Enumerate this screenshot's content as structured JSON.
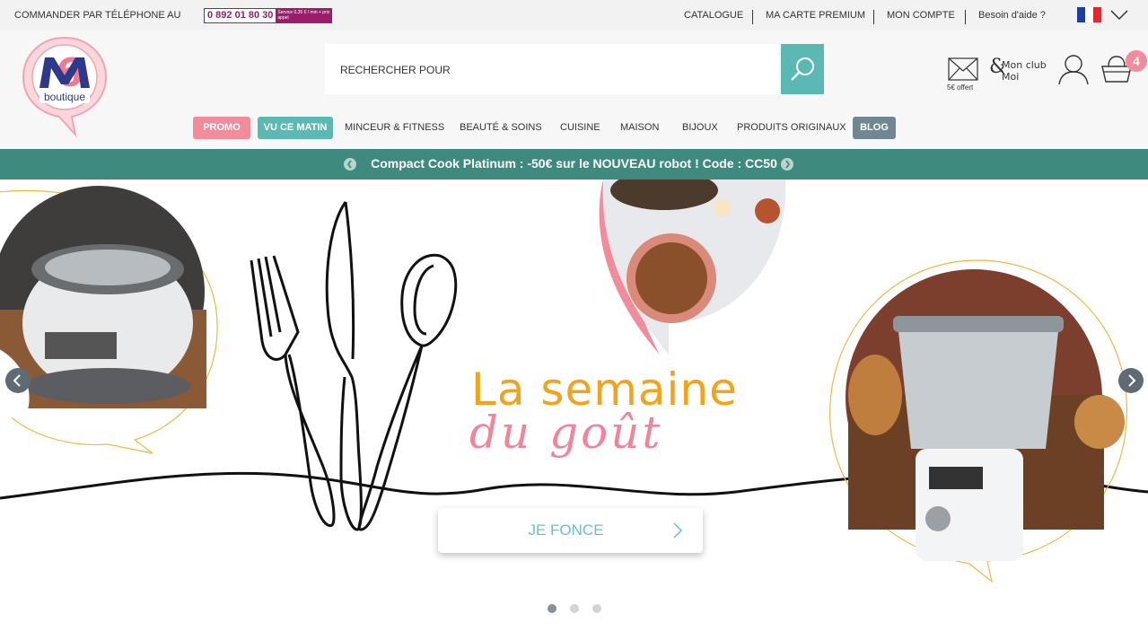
{
  "topbar": {
    "phone_label": "COMMANDER PAR TÉLÉPHONE AU",
    "phone_number": "0 892 01 80 30",
    "phone_service": "Service 0,35 € / min + prix appel",
    "links": [
      "CATALOGUE",
      "MA CARTE PREMIUM",
      "MON COMPTE",
      "Besoin d'aide ?"
    ],
    "flag_colors": [
      "#1f3fa0",
      "#ffffff",
      "#e0262e"
    ]
  },
  "header": {
    "logo_text": "boutique",
    "search_placeholder": "RECHERCHER POUR",
    "mail_label": "5€ offert",
    "club_label_line1": "Mon club",
    "club_label_line2": "Moi",
    "cart_count": "4",
    "icons": [
      "search-icon",
      "mail-icon",
      "club-icon",
      "user-icon",
      "basket-icon",
      "chevron-down-icon"
    ]
  },
  "nav": {
    "items": [
      {
        "label": "PROMO",
        "color": "#f28b9a"
      },
      {
        "label": "VU CE MATIN",
        "color": "#5bb8b2"
      },
      {
        "label": "MINCEUR & FITNESS"
      },
      {
        "label": "BEAUTÉ & SOINS"
      },
      {
        "label": "CUISINE"
      },
      {
        "label": "MAISON"
      },
      {
        "label": "BIJOUX"
      },
      {
        "label": "PRODUITS ORIGINAUX"
      },
      {
        "label": "BLOG",
        "color": "#6f8790"
      }
    ]
  },
  "promo_band": {
    "text": "Compact Cook Platinum : -50€ sur le NOUVEAU robot ! Code : CC50",
    "color": "#3e8a7e"
  },
  "hero": {
    "title": "La semaine",
    "subtitle": "du goût",
    "cta_label": "JE FONCE",
    "slides_total": 3,
    "active_slide": 1,
    "title_color": "#f3a21a",
    "subtitle_color": "#f1849a"
  }
}
